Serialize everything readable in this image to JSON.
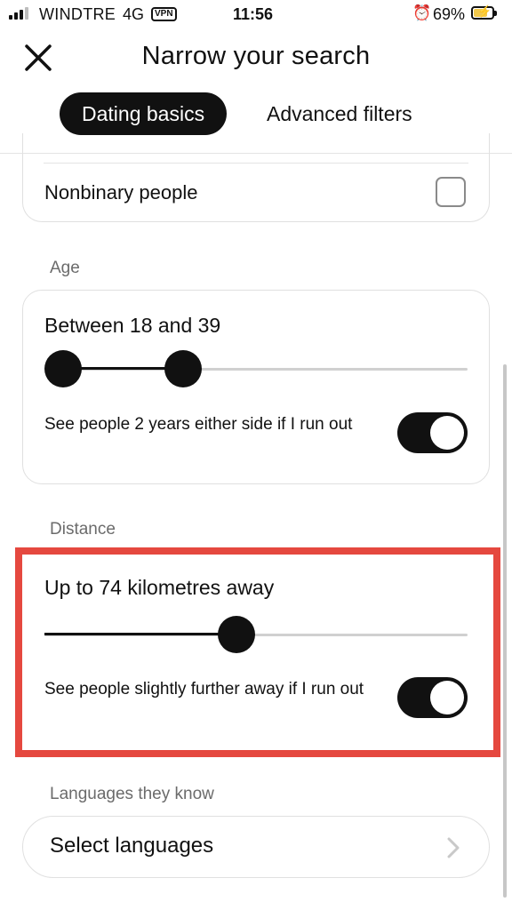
{
  "status_bar": {
    "carrier": "WINDTRE",
    "network": "4G",
    "vpn": "VPN",
    "time": "11:56",
    "battery_percent": "69%",
    "battery_level": 0.69,
    "icons": [
      "signal-icon",
      "alarm-icon",
      "battery-charging-icon"
    ]
  },
  "header": {
    "title": "Narrow your search",
    "close_icon": "close-icon",
    "tabs": [
      {
        "label": "Dating basics",
        "active": true
      },
      {
        "label": "Advanced filters",
        "active": false
      }
    ]
  },
  "gender": {
    "option_label": "Nonbinary people",
    "checked": false
  },
  "age": {
    "section_label": "Age",
    "summary": "Between 18 and 39",
    "slider_min_fraction": 0.0,
    "slider_max_fraction": 0.31,
    "expand_label": "See people 2 years either side if I run out",
    "expand_enabled": true
  },
  "distance": {
    "section_label": "Distance",
    "summary": "Up to 74 kilometres away",
    "slider_fraction": 0.45,
    "expand_label": "See people slightly further away if I run out",
    "expand_enabled": true,
    "highlight_color": "#e5483f"
  },
  "languages": {
    "section_label": "Languages they know",
    "select_label": "Select languages",
    "chevron_icon": "chevron-right-icon"
  },
  "colors": {
    "accent": "#111111",
    "muted_text": "#6b6b6b",
    "border": "#e0e0e0"
  }
}
